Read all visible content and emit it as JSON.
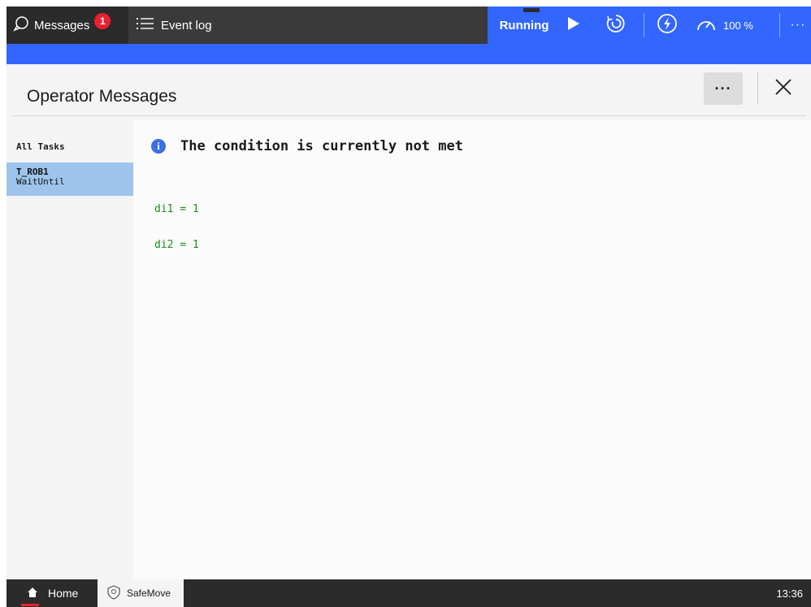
{
  "topbar": {
    "messages_label": "Messages",
    "messages_count": "1",
    "event_log_label": "Event log",
    "status_label": "Running",
    "speed_label": "100 %",
    "more_symbol": "···"
  },
  "header": {
    "title": "Operator Messages",
    "more_symbol": "···"
  },
  "sidebar": {
    "all_tasks_label": "All Tasks",
    "items": [
      {
        "name": "T_ROB1",
        "sub": "WaitUntil"
      }
    ]
  },
  "message": {
    "title": "The condition is currently not met",
    "conditions": [
      "di1 = 1",
      "di2 = 1"
    ]
  },
  "bottombar": {
    "home_label": "Home",
    "safemove_label": "SafeMove",
    "time": "13:36"
  },
  "colors": {
    "accent_blue": "#3366ff",
    "bar_dark": "#2b2b2b",
    "selected_task": "#9fc4ec",
    "badge_red": "#e8212e",
    "condition_green": "#1a8f1a",
    "info_blue": "#3a70e0"
  },
  "icons": [
    "chat-bubble-icon",
    "list-icon",
    "play-icon",
    "cycle-icon",
    "lightning-icon",
    "speedometer-icon",
    "close-icon",
    "info-icon",
    "home-icon",
    "shield-icon"
  ]
}
